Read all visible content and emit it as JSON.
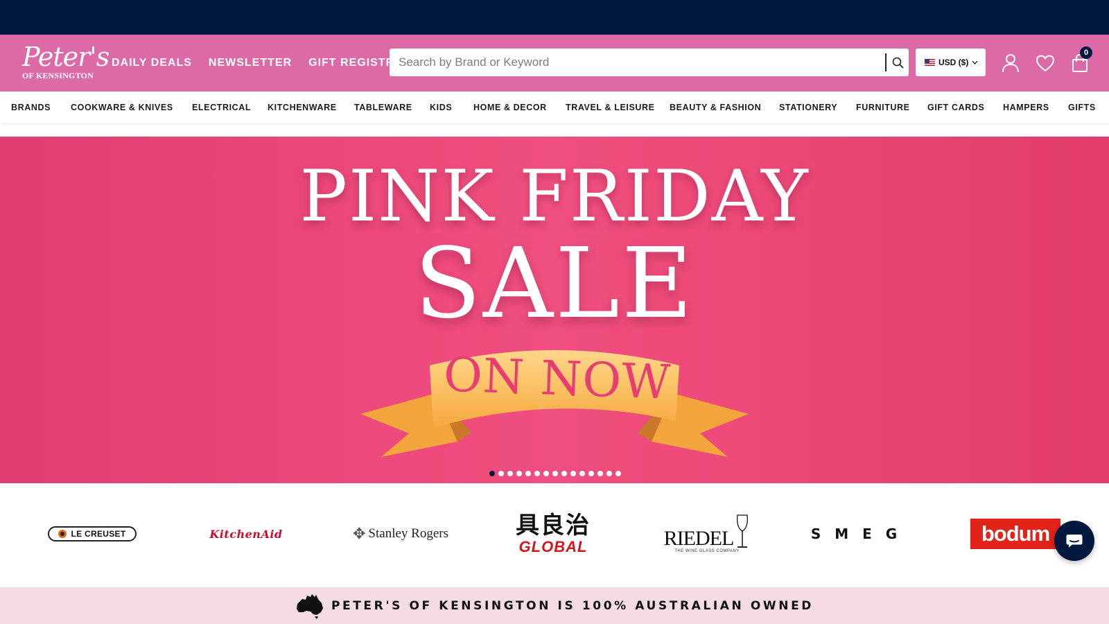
{
  "logo": {
    "script": "Peter's",
    "subtitle": "OF KENSINGTON"
  },
  "top_nav": [
    "DAILY DEALS",
    "NEWSLETTER",
    "GIFT REGISTRY"
  ],
  "search": {
    "placeholder": "Search by Brand or Keyword",
    "value": ""
  },
  "currency": {
    "label": "USD ($)"
  },
  "cart": {
    "count": "0"
  },
  "categories": [
    "BRANDS",
    "COOKWARE & KNIVES",
    "ELECTRICAL",
    "KITCHENWARE",
    "TABLEWARE",
    "KIDS",
    "HOME & DECOR",
    "TRAVEL & LEISURE",
    "BEAUTY & FASHION",
    "STATIONERY",
    "FURNITURE",
    "GIFT CARDS",
    "HAMPERS",
    "GIFTS"
  ],
  "hero": {
    "line1": "PINK FRIDAY",
    "line2": "SALE",
    "ribbon": "ON NOW",
    "slide_count": 15,
    "active_slide": 1
  },
  "brands": {
    "le_creuset": "LE CREUSET",
    "kitchenaid": "KitchenAid",
    "stanley_rogers": "Stanley Rogers",
    "global_kanji": "具良治",
    "global_word": "GLOBAL",
    "riedel_word": "RIEDEL",
    "riedel_sub": "THE WINE GLASS COMPANY",
    "smeg": "SMEG",
    "bodum": "bodum"
  },
  "banner": {
    "text": "PETER'S OF KENSINGTON IS 100% AUSTRALIAN OWNED"
  },
  "colors": {
    "navy": "#02183f",
    "header_pink": "#dc6aa6",
    "hero_pink": "#ec4a7a",
    "ribbon_orange": "#f7b64f",
    "banner_pink": "#f5dbe5"
  },
  "icons": [
    "search-icon",
    "us-flag-icon",
    "chevron-down-icon",
    "account-icon",
    "heart-icon",
    "shopping-bag-icon",
    "chat-icon",
    "australia-map-icon"
  ]
}
